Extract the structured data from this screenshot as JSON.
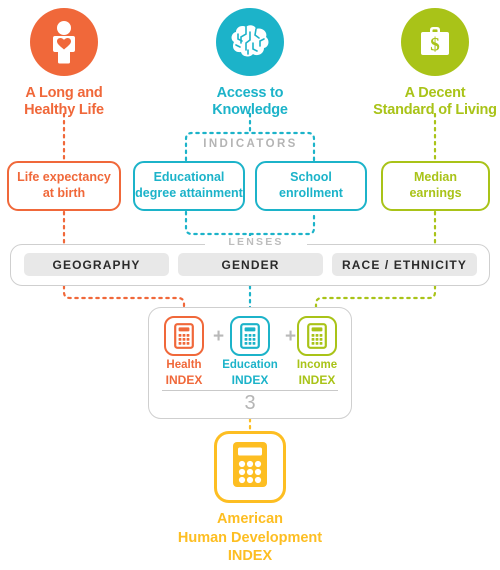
{
  "colors": {
    "health": "#F0683A",
    "education": "#1CB3C9",
    "income": "#A9C318",
    "final": "#FDBE22",
    "gray_caption": "#bdbdbd",
    "gray_line": "#cfcfcf",
    "lens_pill_bg": "#e8e8e8",
    "lens_pill_text": "#2b2b2b"
  },
  "pillars": [
    {
      "id": "health",
      "icon": "person-heart-icon",
      "label_line1": "A Long and",
      "label_line2": "Healthy Life",
      "color": "#F0683A"
    },
    {
      "id": "education",
      "icon": "brain-icon",
      "label_line1": "Access to",
      "label_line2": "Knowledge",
      "color": "#1CB3C9"
    },
    {
      "id": "income",
      "icon": "briefcase-dollar-icon",
      "label_line1": "A Decent",
      "label_line2": "Standard of Living",
      "color": "#A9C318"
    }
  ],
  "indicators": {
    "caption": "INDICATORS",
    "items": [
      {
        "id": "life-expectancy",
        "line1": "Life expectancy",
        "line2": "at birth",
        "color": "#F0683A"
      },
      {
        "id": "educational-degree-attainment",
        "line1": "Educational",
        "line2": "degree attainment",
        "color": "#1CB3C9"
      },
      {
        "id": "school-enrollment",
        "line1": "School",
        "line2": "enrollment",
        "color": "#1CB3C9"
      },
      {
        "id": "median-earnings",
        "line1": "Median",
        "line2": "earnings",
        "color": "#A9C318"
      }
    ]
  },
  "lenses": {
    "caption": "LENSES",
    "items": [
      {
        "id": "geography",
        "label": "GEOGRAPHY"
      },
      {
        "id": "gender",
        "label": "GENDER"
      },
      {
        "id": "race-ethnicity",
        "label": "RACE / ETHNICITY"
      }
    ]
  },
  "index_sum": {
    "operator": "+",
    "denominator": "3",
    "components": [
      {
        "id": "health-index",
        "name": "Health",
        "word": "INDEX",
        "color": "#F0683A",
        "icon": "calculator-icon"
      },
      {
        "id": "education-index",
        "name": "Education",
        "word": "INDEX",
        "color": "#1CB3C9",
        "icon": "calculator-icon"
      },
      {
        "id": "income-index",
        "name": "Income",
        "word": "INDEX",
        "color": "#A9C318",
        "icon": "calculator-icon"
      }
    ]
  },
  "final_index": {
    "icon": "calculator-icon",
    "color": "#FDBE22",
    "line1": "American",
    "line2": "Human Development",
    "line3": "INDEX"
  }
}
